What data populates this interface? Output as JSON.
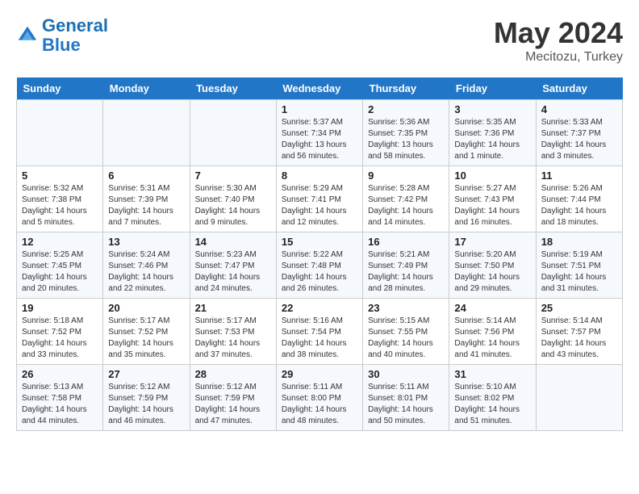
{
  "header": {
    "logo_line1": "General",
    "logo_line2": "Blue",
    "month_year": "May 2024",
    "location": "Mecitozu, Turkey"
  },
  "weekdays": [
    "Sunday",
    "Monday",
    "Tuesday",
    "Wednesday",
    "Thursday",
    "Friday",
    "Saturday"
  ],
  "weeks": [
    [
      {
        "day": "",
        "sunrise": "",
        "sunset": "",
        "daylight": ""
      },
      {
        "day": "",
        "sunrise": "",
        "sunset": "",
        "daylight": ""
      },
      {
        "day": "",
        "sunrise": "",
        "sunset": "",
        "daylight": ""
      },
      {
        "day": "1",
        "sunrise": "Sunrise: 5:37 AM",
        "sunset": "Sunset: 7:34 PM",
        "daylight": "Daylight: 13 hours and 56 minutes."
      },
      {
        "day": "2",
        "sunrise": "Sunrise: 5:36 AM",
        "sunset": "Sunset: 7:35 PM",
        "daylight": "Daylight: 13 hours and 58 minutes."
      },
      {
        "day": "3",
        "sunrise": "Sunrise: 5:35 AM",
        "sunset": "Sunset: 7:36 PM",
        "daylight": "Daylight: 14 hours and 1 minute."
      },
      {
        "day": "4",
        "sunrise": "Sunrise: 5:33 AM",
        "sunset": "Sunset: 7:37 PM",
        "daylight": "Daylight: 14 hours and 3 minutes."
      }
    ],
    [
      {
        "day": "5",
        "sunrise": "Sunrise: 5:32 AM",
        "sunset": "Sunset: 7:38 PM",
        "daylight": "Daylight: 14 hours and 5 minutes."
      },
      {
        "day": "6",
        "sunrise": "Sunrise: 5:31 AM",
        "sunset": "Sunset: 7:39 PM",
        "daylight": "Daylight: 14 hours and 7 minutes."
      },
      {
        "day": "7",
        "sunrise": "Sunrise: 5:30 AM",
        "sunset": "Sunset: 7:40 PM",
        "daylight": "Daylight: 14 hours and 9 minutes."
      },
      {
        "day": "8",
        "sunrise": "Sunrise: 5:29 AM",
        "sunset": "Sunset: 7:41 PM",
        "daylight": "Daylight: 14 hours and 12 minutes."
      },
      {
        "day": "9",
        "sunrise": "Sunrise: 5:28 AM",
        "sunset": "Sunset: 7:42 PM",
        "daylight": "Daylight: 14 hours and 14 minutes."
      },
      {
        "day": "10",
        "sunrise": "Sunrise: 5:27 AM",
        "sunset": "Sunset: 7:43 PM",
        "daylight": "Daylight: 14 hours and 16 minutes."
      },
      {
        "day": "11",
        "sunrise": "Sunrise: 5:26 AM",
        "sunset": "Sunset: 7:44 PM",
        "daylight": "Daylight: 14 hours and 18 minutes."
      }
    ],
    [
      {
        "day": "12",
        "sunrise": "Sunrise: 5:25 AM",
        "sunset": "Sunset: 7:45 PM",
        "daylight": "Daylight: 14 hours and 20 minutes."
      },
      {
        "day": "13",
        "sunrise": "Sunrise: 5:24 AM",
        "sunset": "Sunset: 7:46 PM",
        "daylight": "Daylight: 14 hours and 22 minutes."
      },
      {
        "day": "14",
        "sunrise": "Sunrise: 5:23 AM",
        "sunset": "Sunset: 7:47 PM",
        "daylight": "Daylight: 14 hours and 24 minutes."
      },
      {
        "day": "15",
        "sunrise": "Sunrise: 5:22 AM",
        "sunset": "Sunset: 7:48 PM",
        "daylight": "Daylight: 14 hours and 26 minutes."
      },
      {
        "day": "16",
        "sunrise": "Sunrise: 5:21 AM",
        "sunset": "Sunset: 7:49 PM",
        "daylight": "Daylight: 14 hours and 28 minutes."
      },
      {
        "day": "17",
        "sunrise": "Sunrise: 5:20 AM",
        "sunset": "Sunset: 7:50 PM",
        "daylight": "Daylight: 14 hours and 29 minutes."
      },
      {
        "day": "18",
        "sunrise": "Sunrise: 5:19 AM",
        "sunset": "Sunset: 7:51 PM",
        "daylight": "Daylight: 14 hours and 31 minutes."
      }
    ],
    [
      {
        "day": "19",
        "sunrise": "Sunrise: 5:18 AM",
        "sunset": "Sunset: 7:52 PM",
        "daylight": "Daylight: 14 hours and 33 minutes."
      },
      {
        "day": "20",
        "sunrise": "Sunrise: 5:17 AM",
        "sunset": "Sunset: 7:52 PM",
        "daylight": "Daylight: 14 hours and 35 minutes."
      },
      {
        "day": "21",
        "sunrise": "Sunrise: 5:17 AM",
        "sunset": "Sunset: 7:53 PM",
        "daylight": "Daylight: 14 hours and 37 minutes."
      },
      {
        "day": "22",
        "sunrise": "Sunrise: 5:16 AM",
        "sunset": "Sunset: 7:54 PM",
        "daylight": "Daylight: 14 hours and 38 minutes."
      },
      {
        "day": "23",
        "sunrise": "Sunrise: 5:15 AM",
        "sunset": "Sunset: 7:55 PM",
        "daylight": "Daylight: 14 hours and 40 minutes."
      },
      {
        "day": "24",
        "sunrise": "Sunrise: 5:14 AM",
        "sunset": "Sunset: 7:56 PM",
        "daylight": "Daylight: 14 hours and 41 minutes."
      },
      {
        "day": "25",
        "sunrise": "Sunrise: 5:14 AM",
        "sunset": "Sunset: 7:57 PM",
        "daylight": "Daylight: 14 hours and 43 minutes."
      }
    ],
    [
      {
        "day": "26",
        "sunrise": "Sunrise: 5:13 AM",
        "sunset": "Sunset: 7:58 PM",
        "daylight": "Daylight: 14 hours and 44 minutes."
      },
      {
        "day": "27",
        "sunrise": "Sunrise: 5:12 AM",
        "sunset": "Sunset: 7:59 PM",
        "daylight": "Daylight: 14 hours and 46 minutes."
      },
      {
        "day": "28",
        "sunrise": "Sunrise: 5:12 AM",
        "sunset": "Sunset: 7:59 PM",
        "daylight": "Daylight: 14 hours and 47 minutes."
      },
      {
        "day": "29",
        "sunrise": "Sunrise: 5:11 AM",
        "sunset": "Sunset: 8:00 PM",
        "daylight": "Daylight: 14 hours and 48 minutes."
      },
      {
        "day": "30",
        "sunrise": "Sunrise: 5:11 AM",
        "sunset": "Sunset: 8:01 PM",
        "daylight": "Daylight: 14 hours and 50 minutes."
      },
      {
        "day": "31",
        "sunrise": "Sunrise: 5:10 AM",
        "sunset": "Sunset: 8:02 PM",
        "daylight": "Daylight: 14 hours and 51 minutes."
      },
      {
        "day": "",
        "sunrise": "",
        "sunset": "",
        "daylight": ""
      }
    ]
  ]
}
